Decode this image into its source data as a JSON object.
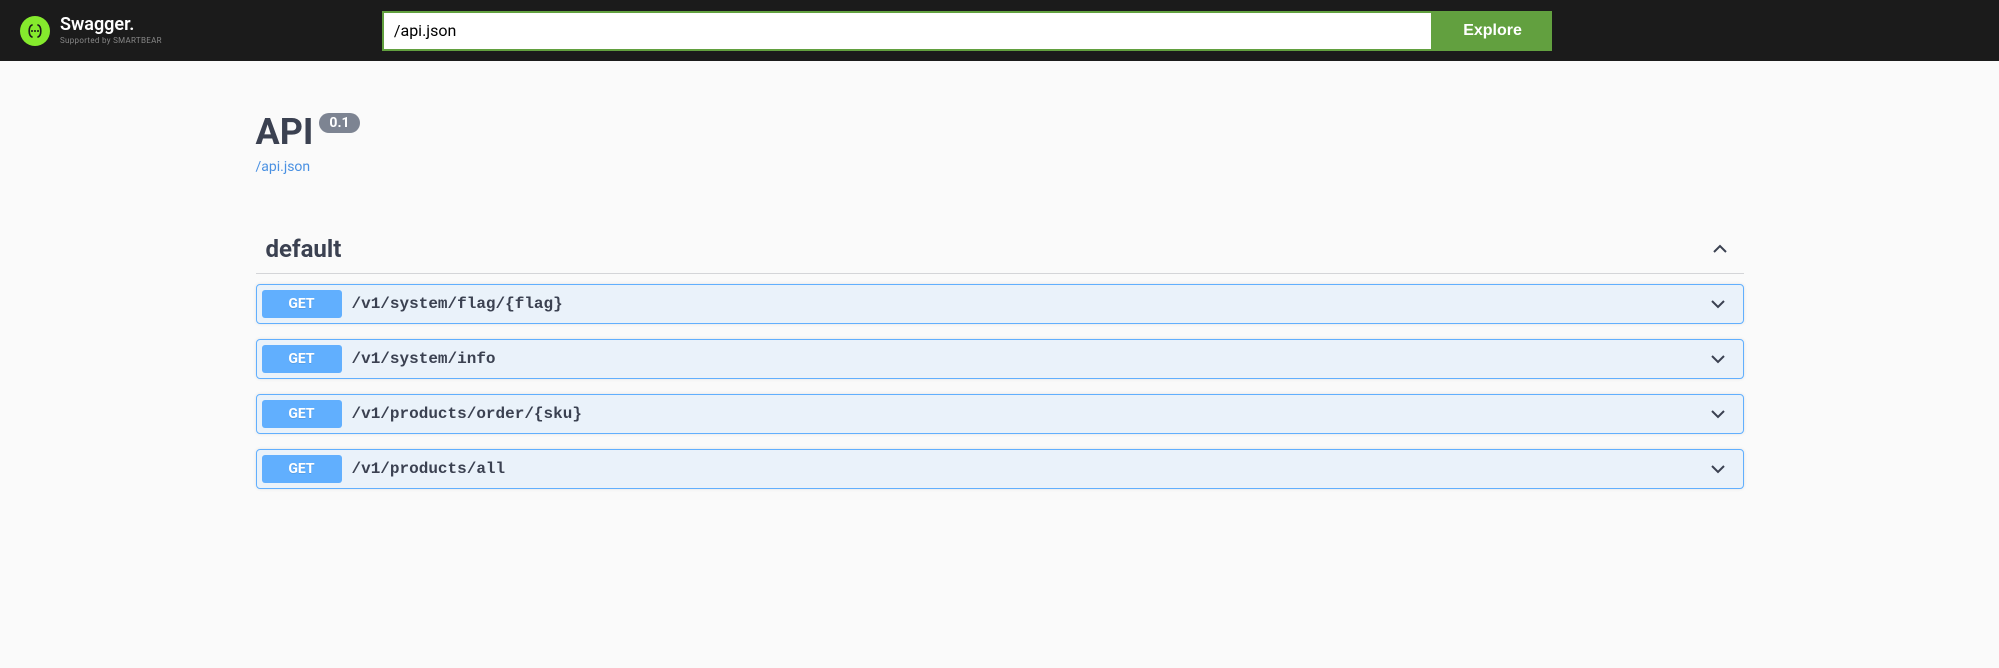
{
  "topbar": {
    "logo_title": "Swagger.",
    "logo_subtitle": "Supported by SMARTBEAR",
    "input_value": "/api.json",
    "explore_label": "Explore"
  },
  "info": {
    "title": "API",
    "version": "0.1",
    "spec_link": "/api.json"
  },
  "tag": {
    "name": "default"
  },
  "operations": [
    {
      "method": "GET",
      "path": "/v1/system/flag/{flag}"
    },
    {
      "method": "GET",
      "path": "/v1/system/info"
    },
    {
      "method": "GET",
      "path": "/v1/products/order/{sku}"
    },
    {
      "method": "GET",
      "path": "/v1/products/all"
    }
  ]
}
